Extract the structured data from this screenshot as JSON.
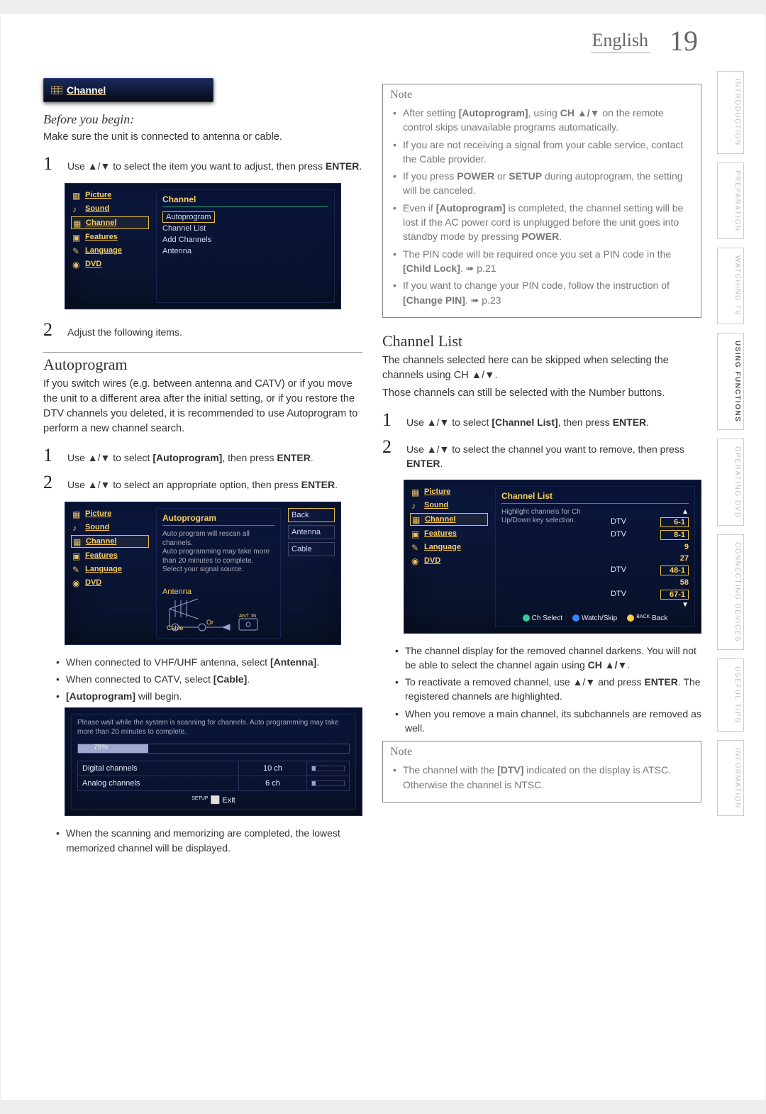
{
  "header": {
    "language": "English",
    "page_number": "19"
  },
  "side_tabs": [
    {
      "label": "INTRODUCTION",
      "active": false
    },
    {
      "label": "PREPARATION",
      "active": false
    },
    {
      "label": "WATCHING TV",
      "active": false
    },
    {
      "label": "USING FUNCTIONS",
      "active": true
    },
    {
      "label": "OPERATING DVD",
      "active": false
    },
    {
      "label": "CONNECTING DEVICES",
      "active": false
    },
    {
      "label": "USEFUL TIPS",
      "active": false
    },
    {
      "label": "INFORMATION",
      "active": false
    }
  ],
  "banner": {
    "label": "Channel"
  },
  "before_begin": {
    "heading": "Before you begin:",
    "text": "Make sure the unit is connected to antenna or cable."
  },
  "left_steps_a": [
    "Use ▲/▼ to select the item you want to adjust, then press ENTER.",
    "Adjust the following items."
  ],
  "osd_menu_items": [
    {
      "label": "Picture"
    },
    {
      "label": "Sound"
    },
    {
      "label": "Channel",
      "selected": true
    },
    {
      "label": "Features"
    },
    {
      "label": "Language"
    },
    {
      "label": "DVD"
    }
  ],
  "osd1_pane": {
    "title": "Channel",
    "rows": [
      "Autoprogram",
      "Channel List",
      "Add Channels",
      "Antenna"
    ],
    "current": 0
  },
  "autoprogram": {
    "title": "Autoprogram",
    "intro": "If you switch wires (e.g. between antenna and CATV) or if you move the unit to a different area after the initial setting, or if you restore the DTV channels you deleted, it is recommended to use Autoprogram to perform a new channel search.",
    "steps": [
      "Use ▲/▼ to select [Autoprogram], then press ENTER.",
      "Use ▲/▼ to select an appropriate option, then press ENTER."
    ],
    "osd_pane": {
      "title": "Autoprogram",
      "note_lines": [
        "Auto program will rescan all channels.",
        "Auto programming may take more than 20 minutes to complete.",
        "Select your signal source."
      ],
      "right_buttons": [
        "Back",
        "Antenna",
        "Cable"
      ],
      "antenna_label": "Antenna",
      "cable_label": "Cable",
      "or_label": "Or",
      "antin_label": "ANT. IN"
    },
    "bullets": [
      "When connected to VHF/UHF antenna, select [Antenna].",
      "When connected to CATV, select [Cable].",
      "[Autoprogram] will begin."
    ],
    "progress_osd": {
      "wait_text": "Please wait while the system is scanning for channels. Auto programming may take more than 20 minutes to complete.",
      "percent": "75%",
      "digital": {
        "label": "Digital channels",
        "value": "10 ch"
      },
      "analog": {
        "label": "Analog channels",
        "value": "6 ch"
      },
      "exit": "Exit",
      "setup_label": "SETUP"
    },
    "post_bullet": "When the scanning and memorizing are completed, the lowest memorized channel will be displayed."
  },
  "right_note_1": {
    "title": "Note",
    "items": [
      "After setting [Autoprogram], using CH ▲/▼ on the remote control skips unavailable programs automatically.",
      "If you are not receiving a signal from your cable service, contact the Cable provider.",
      "If you press POWER or SETUP during autoprogram, the setting will be canceled.",
      "Even if [Autoprogram] is completed, the channel setting will be lost if the AC power cord is unplugged before the unit goes into standby mode by pressing POWER.",
      "The PIN code will be required once you set a PIN code in the [Child Lock]. ➠ p.21",
      "If you want to change your PIN code, follow the instruction of [Change PIN]. ➠ p.23"
    ]
  },
  "channel_list": {
    "title": "Channel List",
    "intro1": "The channels selected here can be skipped when selecting the channels using CH ▲/▼.",
    "intro2": "Those channels can still be selected with the Number buttons.",
    "steps": [
      "Use ▲/▼ to select [Channel List], then press ENTER.",
      "Use ▲/▼ to select the channel you want to remove, then press ENTER."
    ],
    "osd": {
      "pane_title": "Channel List",
      "hint": "Highlight channels for Ch Up/Down key selection.",
      "rows": [
        {
          "type": "DTV",
          "num": "6-1"
        },
        {
          "type": "DTV",
          "num": "8-1"
        },
        {
          "type": "",
          "num": "9"
        },
        {
          "type": "",
          "num": "27"
        },
        {
          "type": "DTV",
          "num": "48-1"
        },
        {
          "type": "",
          "num": "58"
        },
        {
          "type": "DTV",
          "num": "67-1"
        }
      ],
      "buttons": {
        "select": "Ch Select",
        "watch": "Watch/Skip",
        "back": "Back",
        "back_icon": "BACK"
      }
    },
    "bullets": [
      "The channel display for the removed channel darkens. You will not be able to select the channel again using CH ▲/▼.",
      "To reactivate a removed channel, use ▲/▼ and press ENTER. The registered channels are highlighted.",
      "When you remove a main channel, its subchannels are removed as well."
    ]
  },
  "right_note_2": {
    "title": "Note",
    "items": [
      "The channel with the [DTV] indicated on the display is ATSC. Otherwise the channel is NTSC."
    ]
  }
}
